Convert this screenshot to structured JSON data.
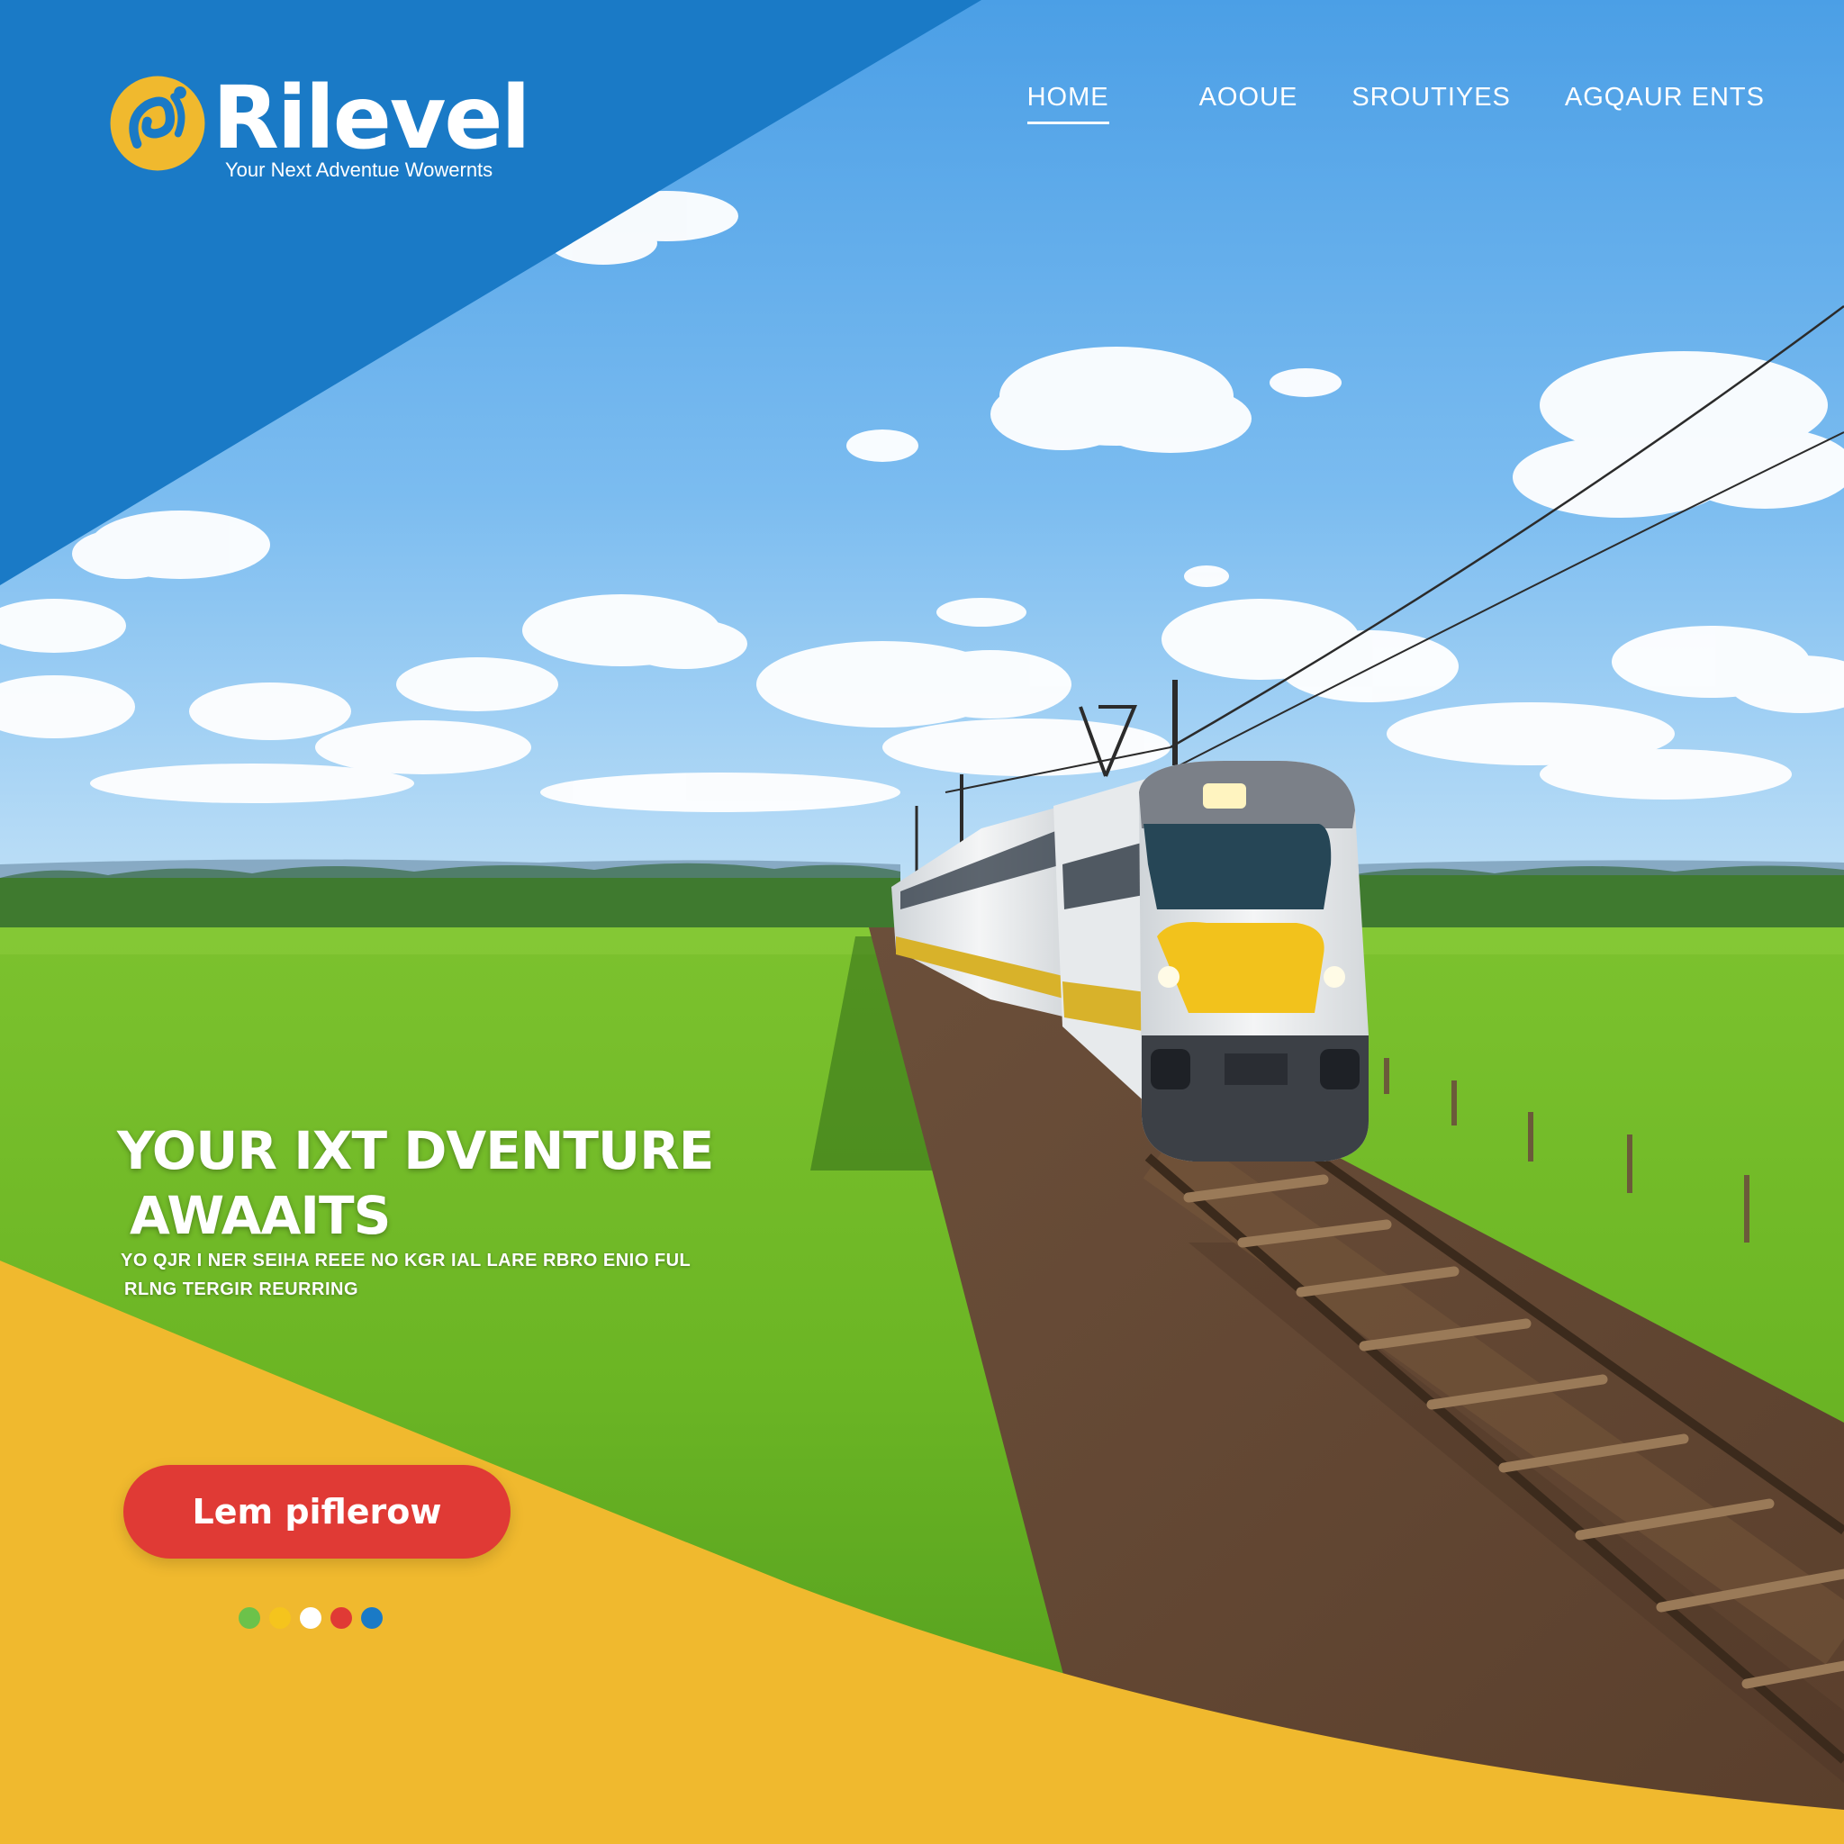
{
  "brand": {
    "name": "Rilevel",
    "tagline": "Your Next Adventue Wowernts"
  },
  "nav": {
    "items": [
      {
        "label": "HOME",
        "active": true
      },
      {
        "label": "AOOUE",
        "active": false
      },
      {
        "label": "SROUTIYES",
        "active": false
      },
      {
        "label": "AGQAUR ENTS",
        "active": false
      }
    ]
  },
  "hero": {
    "title_line1": "YOUR IXT DVENTURE",
    "title_line2": "AWAAITS",
    "subtitle_line1": "YO QJR I NER SEIHA REEE NO KGR IAL LARE RBRO ENIO FUL",
    "subtitle_line2": "RLNG TERGIR REURRING",
    "cta_label": "Lem piflerow"
  },
  "carousel": {
    "dot_colors": [
      "#6cc24a",
      "#f5c41d",
      "#ffffff",
      "#e03a35",
      "#1a7ac6"
    ]
  },
  "colors": {
    "brand_blue": "#1a7ac6",
    "brand_yellow": "#f0b92e",
    "cta_red": "#e03a35"
  },
  "icons": {
    "logo": "swirl-logo-icon"
  }
}
